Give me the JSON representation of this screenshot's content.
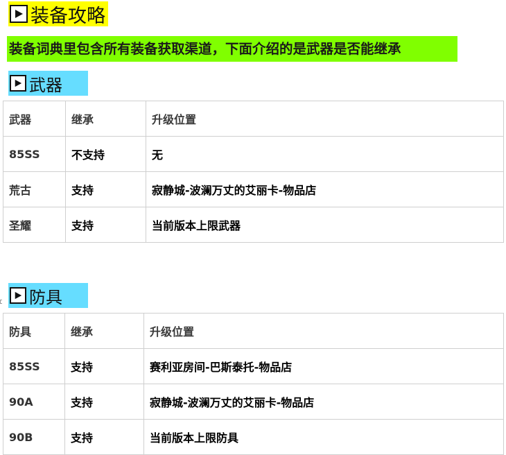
{
  "heading": {
    "title": "装备攻略",
    "icon": "play-icon"
  },
  "intro": {
    "text": "装备词典里包含所有装备获取渠道，下面介绍的是武器是否能继承"
  },
  "weapons": {
    "heading": "武器",
    "icon": "play-icon",
    "columns": [
      "武器",
      "继承",
      "升级位置"
    ],
    "rows": [
      [
        "85SS",
        "不支持",
        "无"
      ],
      [
        "荒古",
        "支持",
        "寂静城-波澜万丈的艾丽卡-物品店"
      ],
      [
        "圣耀",
        "支持",
        "当前版本上限武器"
      ]
    ]
  },
  "armor": {
    "heading": "防具",
    "icon": "play-icon",
    "columns": [
      "防具",
      "继承",
      "升级位置"
    ],
    "rows": [
      [
        "85SS",
        "支持",
        "赛利亚房间-巴斯泰托-物品店"
      ],
      [
        "90A",
        "支持",
        "寂静城-波澜万丈的艾丽卡-物品店"
      ],
      [
        "90B",
        "支持",
        "当前版本上限防具"
      ]
    ]
  },
  "colors": {
    "title_bg": "#ffff00",
    "intro_bg": "#80ff00",
    "section_bg": "#66ddff",
    "border": "#cfcfcf"
  }
}
